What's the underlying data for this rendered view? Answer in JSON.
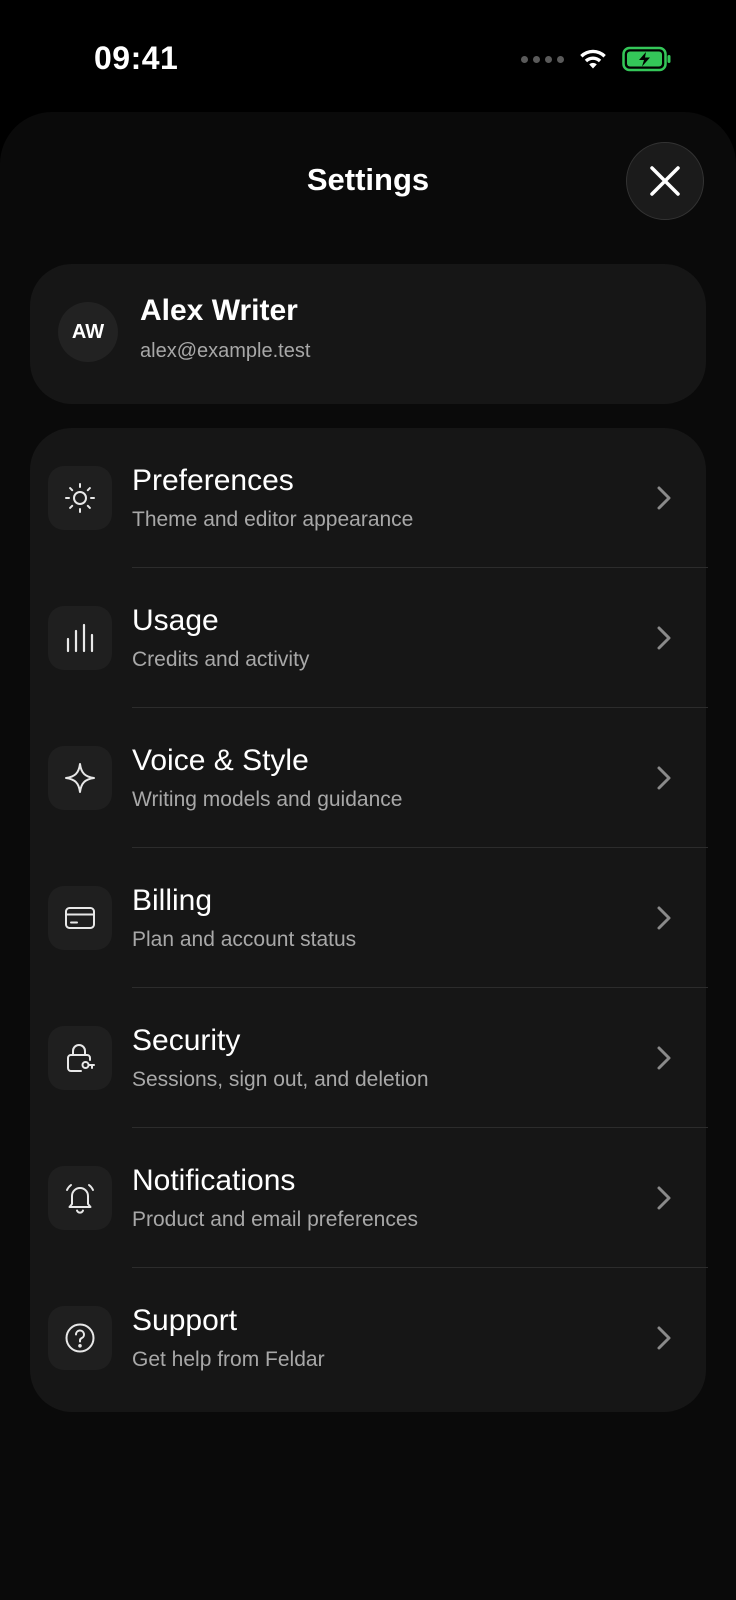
{
  "status_bar": {
    "time": "09:41",
    "icons": [
      "signal-dots-icon",
      "wifi-icon",
      "battery-charging-icon"
    ],
    "battery_color": "#34c759"
  },
  "header": {
    "title": "Settings",
    "close_icon": "close-icon"
  },
  "profile": {
    "initials": "AW",
    "name": "Alex Writer",
    "email": "alex@example.test"
  },
  "menu": {
    "items": [
      {
        "icon": "sun-icon",
        "title": "Preferences",
        "subtitle": "Theme and editor appearance"
      },
      {
        "icon": "bar-chart-icon",
        "title": "Usage",
        "subtitle": "Credits and activity"
      },
      {
        "icon": "sparkle-icon",
        "title": "Voice & Style",
        "subtitle": "Writing models and guidance"
      },
      {
        "icon": "credit-card-icon",
        "title": "Billing",
        "subtitle": "Plan and account status"
      },
      {
        "icon": "lock-key-icon",
        "title": "Security",
        "subtitle": "Sessions, sign out, and deletion"
      },
      {
        "icon": "bell-icon",
        "title": "Notifications",
        "subtitle": "Product and email preferences"
      },
      {
        "icon": "help-circle-icon",
        "title": "Support",
        "subtitle": "Get help from Feldar"
      }
    ]
  },
  "colors": {
    "background": "#000000",
    "sheet": "#0a0a0a",
    "card": "#161616",
    "secondary_text": "#a8a8a8"
  }
}
